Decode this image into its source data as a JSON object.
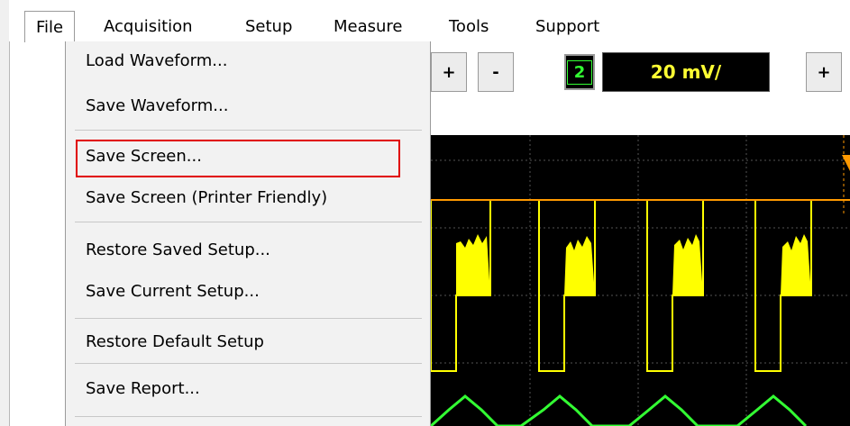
{
  "menubar": {
    "items": [
      "File",
      "Acquisition",
      "Setup",
      "Measure",
      "Tools",
      "Support"
    ]
  },
  "toolbar": {
    "plus_label": "+",
    "minus_label": "-",
    "channel_number": "2",
    "vertical_scale": "20 mV/"
  },
  "file_menu": {
    "items": [
      "Load Waveform...",
      "Save Waveform...",
      "Save Screen...",
      "Save Screen (Printer Friendly)",
      "Restore Saved Setup...",
      "Save Current Setup...",
      "Restore Default Setup",
      "Save Report..."
    ],
    "highlighted_item": "Save Screen..."
  },
  "colors": {
    "channel1_trace": "#ffff00",
    "channel2_trace": "#33ff33",
    "highlight_box": "#e00000",
    "scope_background": "#000000"
  }
}
